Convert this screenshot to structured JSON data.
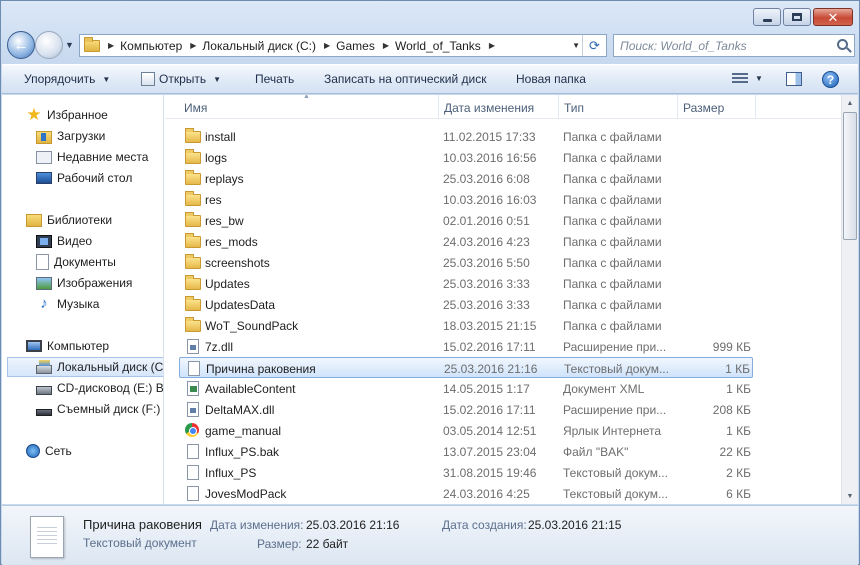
{
  "address": {
    "crumbs": [
      "Компьютер",
      "Локальный диск (C:)",
      "Games",
      "World_of_Tanks"
    ]
  },
  "search": {
    "placeholder": "Поиск: World_of_Tanks"
  },
  "toolbar": {
    "organize": "Упорядочить",
    "open": "Открыть",
    "print": "Печать",
    "burn": "Записать на оптический диск",
    "new_folder": "Новая папка"
  },
  "nav": {
    "favorites": "Избранное",
    "downloads": "Загрузки",
    "recent": "Недавние места",
    "desktop": "Рабочий стол",
    "libraries": "Библиотеки",
    "video": "Видео",
    "documents": "Документы",
    "images": "Изображения",
    "music": "Музыка",
    "computer": "Компьютер",
    "local_disk": "Локальный диск (C:)",
    "cd_drive": "CD-дисковод (E:) Be",
    "removable": "Съемный диск (F:)",
    "network": "Сеть"
  },
  "columns": {
    "name": "Имя",
    "date": "Дата изменения",
    "type": "Тип",
    "size": "Размер"
  },
  "files": [
    {
      "icon": "folder",
      "name": "install",
      "date": "11.02.2015 17:33",
      "type": "Папка с файлами",
      "size": ""
    },
    {
      "icon": "folder",
      "name": "logs",
      "date": "10.03.2016 16:56",
      "type": "Папка с файлами",
      "size": ""
    },
    {
      "icon": "folder",
      "name": "replays",
      "date": "25.03.2016 6:08",
      "type": "Папка с файлами",
      "size": ""
    },
    {
      "icon": "folder",
      "name": "res",
      "date": "10.03.2016 16:03",
      "type": "Папка с файлами",
      "size": ""
    },
    {
      "icon": "folder",
      "name": "res_bw",
      "date": "02.01.2016 0:51",
      "type": "Папка с файлами",
      "size": ""
    },
    {
      "icon": "folder",
      "name": "res_mods",
      "date": "24.03.2016 4:23",
      "type": "Папка с файлами",
      "size": ""
    },
    {
      "icon": "folder",
      "name": "screenshots",
      "date": "25.03.2016 5:50",
      "type": "Папка с файлами",
      "size": ""
    },
    {
      "icon": "folder",
      "name": "Updates",
      "date": "25.03.2016 3:33",
      "type": "Папка с файлами",
      "size": ""
    },
    {
      "icon": "folder",
      "name": "UpdatesData",
      "date": "25.03.2016 3:33",
      "type": "Папка с файлами",
      "size": ""
    },
    {
      "icon": "folder",
      "name": "WoT_SoundPack",
      "date": "18.03.2015 21:15",
      "type": "Папка с файлами",
      "size": ""
    },
    {
      "icon": "dll",
      "name": "7z.dll",
      "date": "15.02.2016 17:11",
      "type": "Расширение при...",
      "size": "999 КБ"
    },
    {
      "icon": "file",
      "name": "Причина раковения",
      "date": "25.03.2016 21:16",
      "type": "Текстовый докум...",
      "size": "1 КБ",
      "selected": true
    },
    {
      "icon": "xml",
      "name": "AvailableContent",
      "date": "14.05.2015 1:17",
      "type": "Документ XML",
      "size": "1 КБ"
    },
    {
      "icon": "dll",
      "name": "DeltaMAX.dll",
      "date": "15.02.2016 17:11",
      "type": "Расширение при...",
      "size": "208 КБ"
    },
    {
      "icon": "url",
      "name": "game_manual",
      "date": "03.05.2014 12:51",
      "type": "Ярлык Интернета",
      "size": "1 КБ"
    },
    {
      "icon": "file",
      "name": "Influx_PS.bak",
      "date": "13.07.2015 23:04",
      "type": "Файл \"BAK\"",
      "size": "22 КБ"
    },
    {
      "icon": "file",
      "name": "Influx_PS",
      "date": "31.08.2015 19:46",
      "type": "Текстовый докум...",
      "size": "2 КБ"
    },
    {
      "icon": "file",
      "name": "JovesModPack",
      "date": "24.03.2016 4:25",
      "type": "Текстовый докум...",
      "size": "6 КБ"
    }
  ],
  "details": {
    "name": "Причина раковения",
    "kind": "Текстовый документ",
    "modified_label": "Дата изменения:",
    "modified_value": "25.03.2016 21:16",
    "created_label": "Дата создания:",
    "created_value": "25.03.2016 21:15",
    "size_label": "Размер:",
    "size_value": "22 байт"
  }
}
